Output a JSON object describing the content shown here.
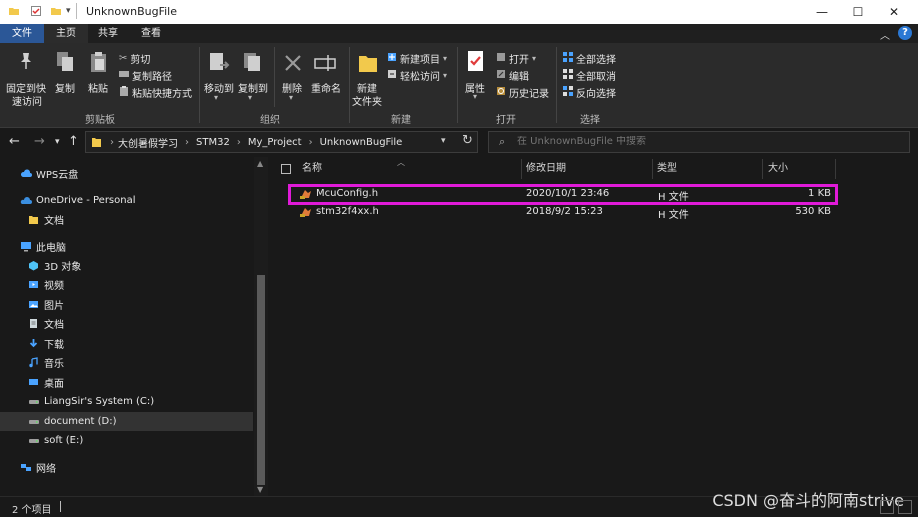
{
  "window": {
    "title": "UnknownBugFile",
    "controls": {
      "minimize": "—",
      "maximize": "☐",
      "close": "✕"
    }
  },
  "tabs": [
    {
      "label": "文件"
    },
    {
      "label": "主页"
    },
    {
      "label": "共享"
    },
    {
      "label": "查看"
    }
  ],
  "ribbon": {
    "clipboard": {
      "pin_label_1": "固定到快",
      "pin_label_2": "速访问",
      "copy": "复制",
      "paste": "粘贴",
      "cut": "剪切",
      "copy_path": "复制路径",
      "paste_shortcut": "粘贴快捷方式",
      "group": "剪贴板"
    },
    "organize": {
      "move_to": "移动到",
      "copy_to": "复制到",
      "delete": "删除",
      "rename": "重命名",
      "group": "组织"
    },
    "new": {
      "new_folder_1": "新建",
      "new_folder_2": "文件夹",
      "new_item": "新建项目",
      "easy_access": "轻松访问",
      "group": "新建"
    },
    "open": {
      "properties": "属性",
      "open": "打开",
      "edit": "编辑",
      "history": "历史记录",
      "group": "打开"
    },
    "select": {
      "select_all": "全部选择",
      "select_none": "全部取消",
      "invert": "反向选择",
      "group": "选择"
    }
  },
  "address": {
    "crumbs": [
      "大创暑假学习",
      "STM32",
      "My_Project",
      "UnknownBugFile"
    ],
    "search_placeholder": "在 UnknownBugFile 中搜索"
  },
  "nav_pane": [
    {
      "label": "WPS云盘",
      "icon": "cloud-icon",
      "color": "#4aa3ff"
    },
    {
      "label": "OneDrive - Personal",
      "icon": "onedrive-icon",
      "color": "#3b8fe0"
    },
    {
      "label": "文档",
      "icon": "folder-icon",
      "color": "#f2c94c"
    },
    {
      "label": "此电脑",
      "icon": "computer-icon",
      "color": "#4aa3ff"
    },
    {
      "label": "3D 对象",
      "icon": "cube-icon",
      "color": "#4fc3f7"
    },
    {
      "label": "视频",
      "icon": "video-icon",
      "color": "#4aa3ff"
    },
    {
      "label": "图片",
      "icon": "picture-icon",
      "color": "#4aa3ff"
    },
    {
      "label": "文档",
      "icon": "document-icon",
      "color": "#cfd8dc"
    },
    {
      "label": "下载",
      "icon": "download-icon",
      "color": "#4aa3ff"
    },
    {
      "label": "音乐",
      "icon": "music-icon",
      "color": "#4aa3ff"
    },
    {
      "label": "桌面",
      "icon": "desktop-icon",
      "color": "#4aa3ff"
    },
    {
      "label": "LiangSir's System (C:)",
      "icon": "drive-icon",
      "color": "#9e9e9e"
    },
    {
      "label": "document (D:)",
      "icon": "drive-icon",
      "color": "#9e9e9e"
    },
    {
      "label": "soft (E:)",
      "icon": "drive-icon",
      "color": "#9e9e9e"
    },
    {
      "label": "网络",
      "icon": "network-icon",
      "color": "#4aa3ff"
    }
  ],
  "file_list": {
    "columns": [
      "名称",
      "修改日期",
      "类型",
      "大小"
    ],
    "rows": [
      {
        "name": "McuConfig.h",
        "modified": "2020/10/1 23:46",
        "type": "H 文件",
        "size": "1 KB"
      },
      {
        "name": "stm32f4xx.h",
        "modified": "2018/9/2 15:23",
        "type": "H 文件",
        "size": "530 KB"
      }
    ]
  },
  "status": {
    "item_count": "2 个项目"
  },
  "watermark": "CSDN @奋斗的阿南strive",
  "colors": {
    "file_tab": "#2b5797",
    "highlight": "#e01ad8",
    "folder": "#f2c94c"
  }
}
